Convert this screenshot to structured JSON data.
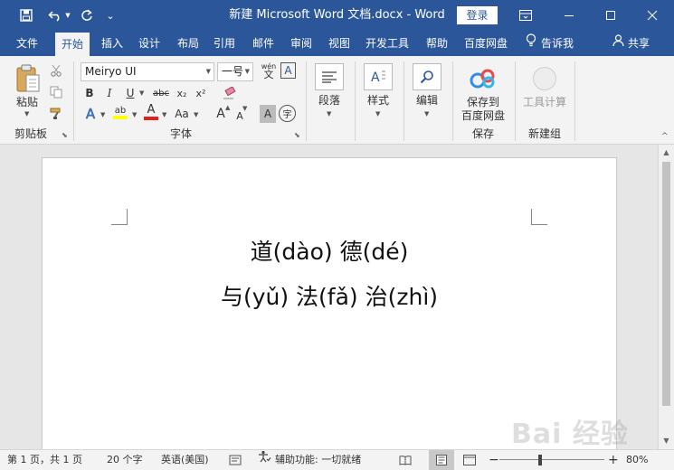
{
  "titlebar": {
    "title": "新建 Microsoft Word 文档.docx - Word",
    "login_label": "登录"
  },
  "tabs": [
    "文件",
    "开始",
    "插入",
    "设计",
    "布局",
    "引用",
    "邮件",
    "审阅",
    "视图",
    "开发工具",
    "帮助",
    "百度网盘"
  ],
  "active_tab": "开始",
  "tell_me": "告诉我",
  "share": "共享",
  "ribbon": {
    "clipboard": {
      "paste_label": "粘贴",
      "group_label": "剪贴板"
    },
    "font": {
      "font_name": "Meiryo UI",
      "font_size": "一号",
      "pinyin_label": "wén",
      "group_label": "字体",
      "bold": "B",
      "italic": "I",
      "underline": "U",
      "strike": "abc",
      "subscript": "x₂",
      "superscript": "x²",
      "font_color_glyph": "A",
      "case_glyph": "Aa",
      "grow_glyph": "A",
      "shrink_glyph": "A",
      "char_shade_glyph": "A",
      "enclose_glyph": "字"
    },
    "paragraph": {
      "label": "段落"
    },
    "styles": {
      "label": "样式"
    },
    "editing": {
      "label": "编辑"
    },
    "save": {
      "button_label_line1": "保存到",
      "button_label_line2": "百度网盘",
      "group_label": "保存"
    },
    "newgroup": {
      "button_label": "工具计算",
      "group_label": "新建组"
    }
  },
  "document": {
    "line1": "道(dào)  德(dé)",
    "line2": "与(yǔ)  法(fǎ)  治(zhì)"
  },
  "statusbar": {
    "page_info": "第 1 页，共 1 页",
    "word_count": "20 个字",
    "language": "英语(美国)",
    "accessibility": "辅助功能: 一切就绪",
    "zoom_percent": "80%",
    "zoom_level": 0.8
  },
  "watermark_text": "Bai 经验",
  "colors": {
    "accent": "#2b579a",
    "ribbon_bg": "#f3f3f3"
  }
}
